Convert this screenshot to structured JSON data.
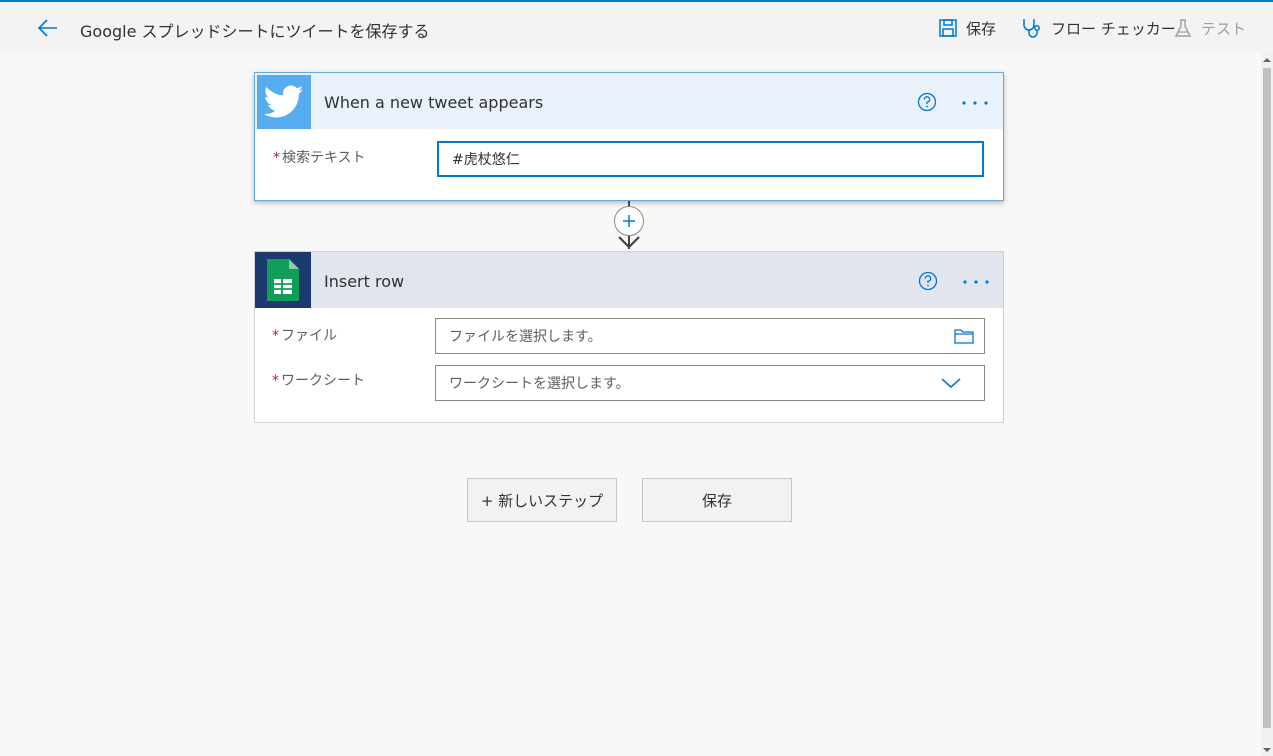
{
  "header": {
    "title": "Google スプレッドシートにツイートを保存する",
    "save_label": "保存",
    "checker_label": "フロー チェッカー",
    "test_label": "テスト"
  },
  "trigger": {
    "title": "When a new tweet appears",
    "search_label": "検索テキスト",
    "search_value": "#虎杖悠仁",
    "required_mark": "*"
  },
  "action": {
    "title": "Insert row",
    "file_label": "ファイル",
    "file_placeholder": "ファイルを選択します。",
    "sheet_label": "ワークシート",
    "sheet_placeholder": "ワークシートを選択します。",
    "required_mark": "*"
  },
  "footer": {
    "new_step_label": "+ 新しいステップ",
    "save_label": "保存"
  },
  "colors": {
    "accent": "#0078d4",
    "twitter": "#55acee",
    "sheets": "#0f9d58",
    "required": "#a4262c"
  },
  "icons": [
    "back-arrow-icon",
    "save-icon",
    "stethoscope-icon",
    "flask-icon",
    "twitter-icon",
    "sheets-icon",
    "help-icon",
    "more-icon",
    "folder-icon",
    "chevron-down-icon",
    "plus-icon",
    "arrow-down-icon"
  ]
}
